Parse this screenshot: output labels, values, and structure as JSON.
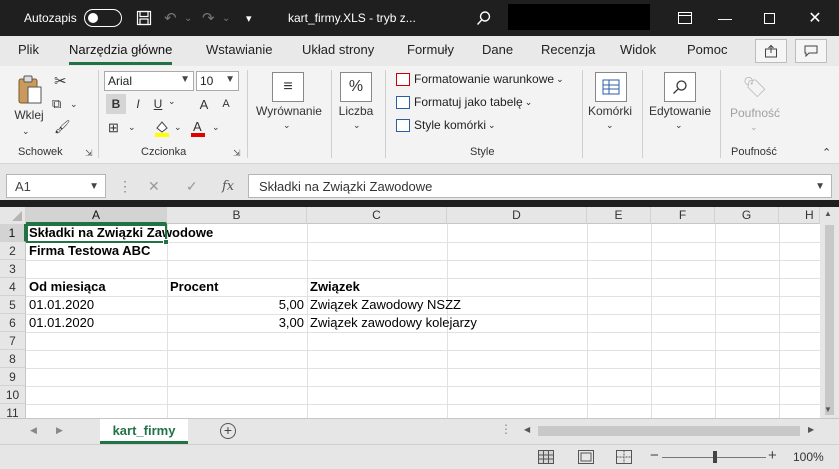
{
  "titlebar": {
    "autosave_label": "Autozapis",
    "title": "kart_firmy.XLS  -  tryb z...",
    "icons": [
      "toggle-off",
      "save-icon",
      "undo-icon",
      "redo-icon",
      "customize-icon",
      "search-icon",
      "restore-icon",
      "minimize-icon",
      "maximize-icon",
      "close-icon"
    ]
  },
  "tabs": [
    "Plik",
    "Narzędzia główne",
    "Wstawianie",
    "Układ strony",
    "Formuły",
    "Dane",
    "Recenzja",
    "Widok",
    "Pomoc"
  ],
  "active_tab": "Narzędzia główne",
  "ribbon": {
    "clipboard": {
      "paste_label": "Wklej",
      "group_label": "Schowek"
    },
    "font": {
      "font_name": "Arial",
      "font_size": "10",
      "bold": "B",
      "italic": "I",
      "underline": "U",
      "grow": "A",
      "shrink": "A",
      "group_label": "Czcionka"
    },
    "alignment": {
      "label": "Wyrównanie"
    },
    "number": {
      "label": "Liczba",
      "icon": "%"
    },
    "styles": {
      "conditional": "Formatowanie warunkowe",
      "as_table": "Formatuj jako tabelę",
      "cell_styles": "Style komórki",
      "group_label": "Style"
    },
    "cells": {
      "label": "Komórki"
    },
    "editing": {
      "label": "Edytowanie"
    },
    "sensitivity": {
      "label": "Poufność",
      "group_label": "Poufność"
    }
  },
  "formula_bar": {
    "name_box": "A1",
    "fx": "fx",
    "content": "Składki na Związki Zawodowe"
  },
  "columns": [
    "A",
    "B",
    "C",
    "D",
    "E",
    "F",
    "G",
    "H"
  ],
  "rows": [
    "1",
    "2",
    "3",
    "4",
    "5",
    "6",
    "7",
    "8",
    "9",
    "10",
    "11"
  ],
  "cells": {
    "A1": "Składki na Związki Zawodowe",
    "A2": "Firma Testowa ABC",
    "A4": "Od miesiąca",
    "B4": "Procent",
    "C4": "Związek",
    "A5": "01.01.2020",
    "B5": "5,00",
    "C5": "Związek Zawodowy NSZZ",
    "A6": "01.01.2020",
    "B6": "3,00",
    "C6": "Związek zawodowy kolejarzy"
  },
  "sheet_tab": "kart_firmy",
  "status": {
    "zoom": "100%",
    "accent": "#217346"
  }
}
